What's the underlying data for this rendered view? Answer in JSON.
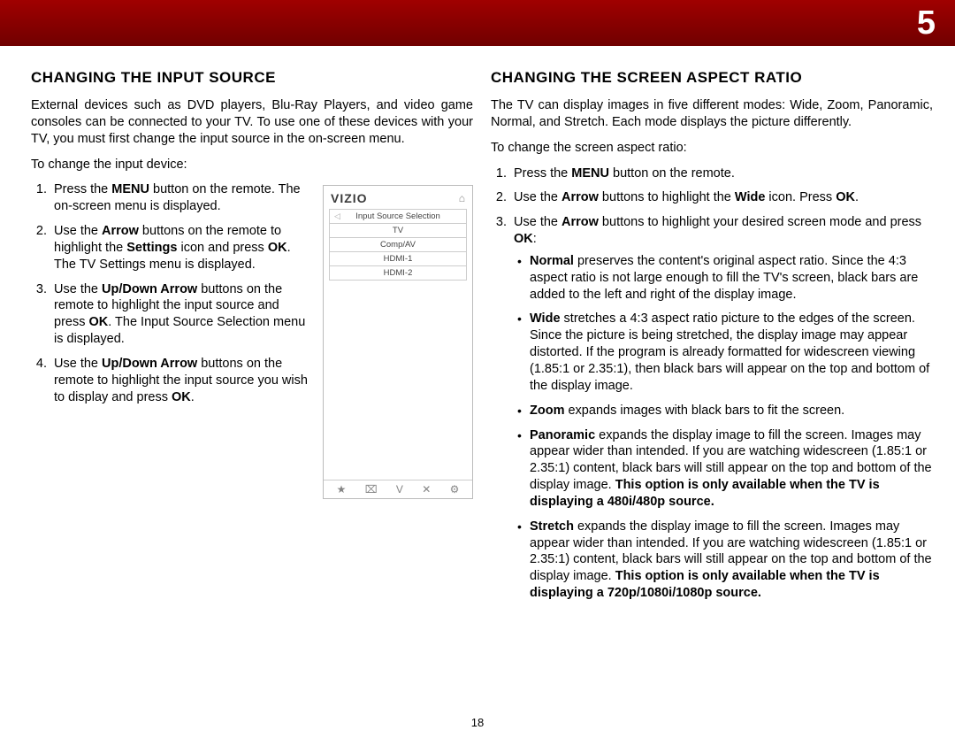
{
  "chapter": "5",
  "page_number": "18",
  "left": {
    "heading": "CHANGING THE INPUT SOURCE",
    "intro": "External devices such as DVD players, Blu-Ray Players, and video game consoles can be connected to your TV. To use one of these devices with your TV, you must first change the input source in the on-screen menu.",
    "lead": "To change the input device:",
    "steps": {
      "s1_pre": "Press the ",
      "s1_b": "MENU",
      "s1_post": " button on the remote. The on-screen menu is displayed.",
      "s2_a": "Use the ",
      "s2_b1": "Arrow",
      "s2_b": " buttons on the remote to highlight the ",
      "s2_b2": "Settings",
      "s2_c": " icon and press ",
      "s2_b3": "OK",
      "s2_d": ". The TV Settings menu is displayed.",
      "s3_a": "Use the ",
      "s3_b1": "Up/Down Arrow",
      "s3_b": " buttons on the remote to highlight the input source and press ",
      "s3_b2": "OK",
      "s3_c": ". The Input Source Selection menu is displayed.",
      "s4_a": "Use the ",
      "s4_b1": "Up/Down Arrow",
      "s4_b": " buttons on the remote to highlight the input source you wish to display and press ",
      "s4_b2": "OK",
      "s4_c": "."
    },
    "screenshot": {
      "logo": "VIZIO",
      "menu_title": "Input Source Selection",
      "items": [
        "TV",
        "Comp/AV",
        "HDMI-1",
        "HDMI-2"
      ],
      "footer": [
        "★",
        "⌧",
        "V",
        "✕",
        "⚙"
      ]
    }
  },
  "right": {
    "heading": "CHANGING THE SCREEN ASPECT RATIO",
    "intro": "The TV can display images in five different modes: Wide, Zoom, Panoramic, Normal, and Stretch. Each mode displays the picture differently.",
    "lead": "To change the screen aspect ratio:",
    "s1_a": "Press the ",
    "s1_b": "MENU",
    "s1_c": " button on the remote.",
    "s2_a": "Use the ",
    "s2_b1": "Arrow",
    "s2_b": " buttons to highlight the ",
    "s2_b2": "Wide",
    "s2_c": " icon. Press ",
    "s2_b3": "OK",
    "s2_d": ".",
    "s3_a": "Use the ",
    "s3_b1": "Arrow",
    "s3_b": " buttons to highlight your desired screen mode and press ",
    "s3_b2": "OK",
    "s3_c": ":",
    "modes": {
      "normal_b": "Normal",
      "normal_t": " preserves the content's original aspect ratio. Since the 4:3 aspect ratio is not large enough to fill the TV's screen, black bars are added to the left and right of the display image.",
      "wide_b": "Wide",
      "wide_t": " stretches a 4:3 aspect ratio picture to the edges of the screen. Since the picture is being stretched, the display image may appear distorted. If the program is already formatted for widescreen viewing (1.85:1 or 2.35:1), then black bars will appear on the top and bottom of the display image.",
      "zoom_b": "Zoom",
      "zoom_t": " expands images with black bars to fit the screen.",
      "pano_b": "Panoramic",
      "pano_t1": " expands the display image to fill the screen. Images may appear wider than intended. If you are watching widescreen (1.85:1 or 2.35:1) content, black bars will still appear on the top and bottom of the display image. ",
      "pano_t2": "This option is only available when the TV is displaying a 480i/480p source.",
      "stretch_b": "Stretch",
      "stretch_t1": " expands the display image to fill the screen. Images may appear wider than intended. If you are watching widescreen (1.85:1 or 2.35:1) content, black bars will still appear on the top and bottom of the display image. ",
      "stretch_t2": "This option is only available when the TV is displaying a 720p/1080i/1080p source."
    }
  }
}
